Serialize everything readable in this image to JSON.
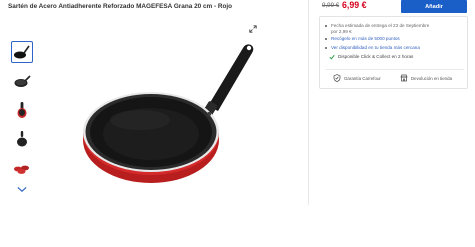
{
  "product": {
    "title": "Sartén de Acero Antiadherente Reforzado MAGEFESA Grana 20 cm - Rojo"
  },
  "pricing": {
    "old_price": "9,99 €",
    "new_price": "6,99 €",
    "add_label": "Añadir"
  },
  "delivery": {
    "estimate_line1": "Fecha estimada de entrega el 23 de Septiembre",
    "estimate_line2": "por 2,99 €",
    "pickup": "Recógelo en más de 5000 puntos",
    "store_availability": "Ver disponibilidad en tu tienda más cercana",
    "click_collect": "Disponible Click & Collect en 2 horas"
  },
  "guarantees": {
    "carrefour": "Garantía Carrefour",
    "returns": "Devolución en tienda"
  },
  "icons": [
    "zoom-expand-icon",
    "chevron-down-icon",
    "check-icon",
    "shield-check-icon",
    "store-icon"
  ],
  "colors": {
    "accent": "#1a5ec8",
    "price": "#d6001c",
    "link": "#2f5fbf",
    "pan_red": "#cc2222"
  }
}
